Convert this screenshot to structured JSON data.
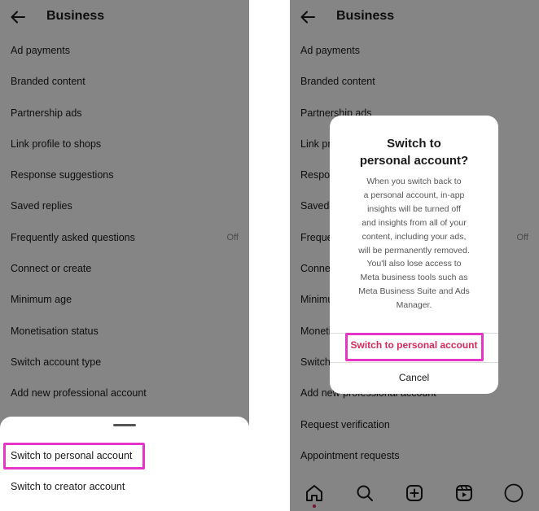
{
  "left": {
    "header": {
      "title": "Business"
    },
    "menu": [
      {
        "label": "Ad payments",
        "status": ""
      },
      {
        "label": "Branded content",
        "status": ""
      },
      {
        "label": "Partnership ads",
        "status": ""
      },
      {
        "label": "Link profile to shops",
        "status": ""
      },
      {
        "label": "Response suggestions",
        "status": ""
      },
      {
        "label": "Saved replies",
        "status": ""
      },
      {
        "label": "Frequently asked questions",
        "status": "Off"
      },
      {
        "label": "Connect or create",
        "status": ""
      },
      {
        "label": "Minimum age",
        "status": ""
      },
      {
        "label": "Monetisation status",
        "status": ""
      },
      {
        "label": "Switch account type",
        "status": ""
      },
      {
        "label": "Add new professional account",
        "status": ""
      }
    ],
    "sheet": {
      "personal_label": "Switch to personal account",
      "creator_label": "Switch to creator account"
    }
  },
  "right": {
    "header": {
      "title": "Business"
    },
    "menu": [
      {
        "label": "Ad payments",
        "status": ""
      },
      {
        "label": "Branded content",
        "status": ""
      },
      {
        "label": "Partnership ads",
        "status": ""
      },
      {
        "label": "Link profile to shops",
        "status": ""
      },
      {
        "label": "Response suggestions",
        "status": ""
      },
      {
        "label": "Saved replies",
        "status": ""
      },
      {
        "label": "Frequently asked questions",
        "status": "Off"
      },
      {
        "label": "Connect or create",
        "status": ""
      },
      {
        "label": "Minimum age",
        "status": ""
      },
      {
        "label": "Monetisation status",
        "status": ""
      },
      {
        "label": "Switch account type",
        "status": ""
      },
      {
        "label": "Add new professional account",
        "status": ""
      },
      {
        "label": "Request verification",
        "status": ""
      },
      {
        "label": "Appointment requests",
        "status": ""
      }
    ],
    "dialog": {
      "title_line1": "Switch to",
      "title_line2": "personal account?",
      "body_lines": [
        "When you switch back to",
        "a personal account, in-app",
        "insights will be turned off",
        "and insights from all of your",
        "content, including your ads,",
        "will be permanently removed.",
        "You'll also lose access to",
        "Meta business tools such as",
        "Meta Business Suite and Ads",
        "Manager."
      ],
      "primary_label": "Switch to personal account",
      "cancel_label": "Cancel"
    },
    "bottom_nav": [
      "home-icon",
      "search-icon",
      "create-icon",
      "reels-icon",
      "profile-icon"
    ]
  },
  "colors": {
    "highlight": "#e535c9",
    "primary_action": "#d62a5a",
    "notification_dot": "#e0245e",
    "overlay": "rgba(0,0,0,0.48)"
  }
}
